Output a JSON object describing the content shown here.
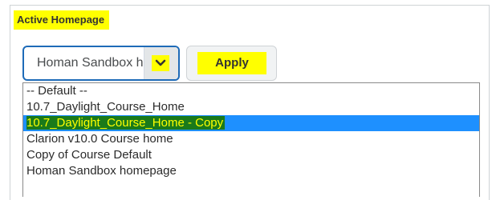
{
  "heading": "Active Homepage",
  "select": {
    "value": "Homan Sandbox homepage",
    "arrow_icon": "chevron-down-icon"
  },
  "apply_label": "Apply",
  "options": [
    "-- Default --",
    "10.7_Daylight_Course_Home",
    "10.7_Daylight_Course_Home - Copy",
    "Clarion v10.0 Course home",
    "Copy of Course Default",
    "Homan Sandbox homepage"
  ],
  "selected_index": 2,
  "colors": {
    "highlight": "#ffff00",
    "select_border": "#1e6bb8",
    "selected_option": "#1e90ff"
  }
}
